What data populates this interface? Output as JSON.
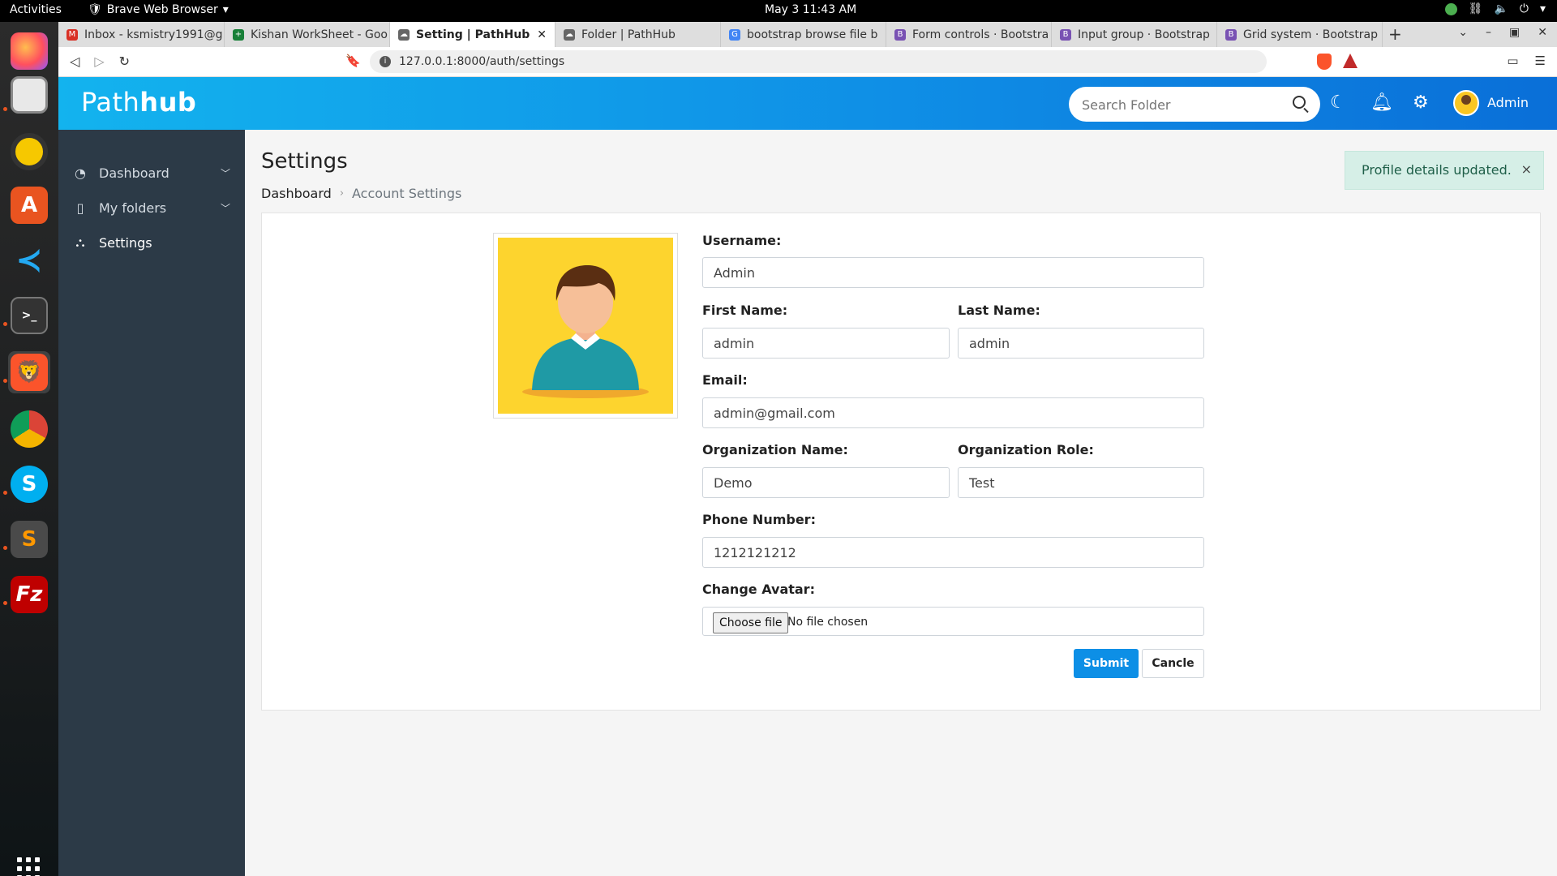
{
  "os": {
    "activities": "Activities",
    "app_menu": "Brave Web Browser",
    "clock": "May 3  11:43 AM"
  },
  "browser": {
    "tabs": [
      {
        "label": "Inbox - ksmistry1991@g",
        "favicon": "gmail-icon",
        "color": "#d93025"
      },
      {
        "label": "Kishan WorkSheet - Goo",
        "favicon": "sheets-icon",
        "color": "#188038"
      },
      {
        "label": "Setting | PathHub",
        "favicon": "cloud-icon",
        "color": "#666666"
      },
      {
        "label": "Folder | PathHub",
        "favicon": "cloud-icon",
        "color": "#666666"
      },
      {
        "label": "bootstrap browse file b",
        "favicon": "google-icon",
        "color": "#4285f4"
      },
      {
        "label": "Form controls · Bootstra",
        "favicon": "bootstrap-icon",
        "color": "#7952b3"
      },
      {
        "label": "Input group · Bootstrap",
        "favicon": "bootstrap-icon",
        "color": "#7952b3"
      },
      {
        "label": "Grid system · Bootstrap",
        "favicon": "bootstrap-icon",
        "color": "#7952b3"
      }
    ],
    "active_tab_index": 2,
    "url": "127.0.0.1:8000/auth/settings"
  },
  "header": {
    "logo_prefix": "Path",
    "logo_suffix": "hub",
    "search_placeholder": "Search Folder",
    "user_name": "Admin"
  },
  "sidebar": {
    "items": [
      {
        "label": "Dashboard",
        "icon": "gauge-icon",
        "has_children": true
      },
      {
        "label": "My folders",
        "icon": "bookmark-icon",
        "has_children": true
      },
      {
        "label": "Settings",
        "icon": "settings-nodes-icon",
        "has_children": false
      }
    ]
  },
  "page": {
    "title": "Settings",
    "breadcrumb": {
      "parent": "Dashboard",
      "current": "Account Settings"
    },
    "alert": "Profile details updated."
  },
  "form": {
    "username_label": "Username:",
    "username_value": "Admin",
    "first_name_label": "First Name:",
    "first_name_value": "admin",
    "last_name_label": "Last Name:",
    "last_name_value": "admin",
    "email_label": "Email:",
    "email_value": "admin@gmail.com",
    "org_name_label": "Organization Name:",
    "org_name_value": "Demo",
    "org_role_label": "Organization Role:",
    "org_role_value": "Test",
    "phone_label": "Phone Number:",
    "phone_value": "1212121212",
    "avatar_label": "Change Avatar:",
    "choose_file": "Choose file",
    "no_file": "No file chosen",
    "submit": "Submit",
    "cancel": "Cancle"
  },
  "colors": {
    "header_start": "#13b3ee",
    "header_end": "#0a6fd8",
    "sidebar": "#2c3a47",
    "primary": "#0d8fe6",
    "alert_bg": "#d6efe7"
  }
}
